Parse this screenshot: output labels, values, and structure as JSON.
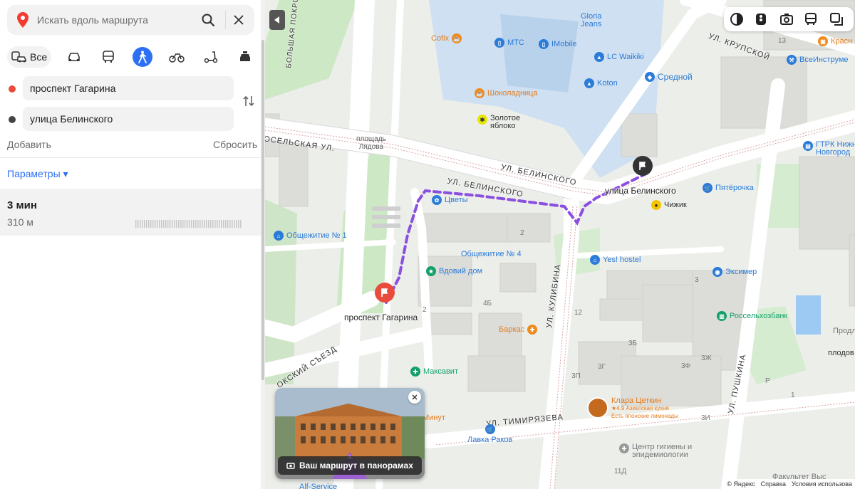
{
  "search": {
    "placeholder": "Искать вдоль маршрута"
  },
  "modes": {
    "all_label": "Все",
    "items": [
      "car-icon",
      "bus-icon",
      "pedestrian-icon",
      "bicycle-icon",
      "scooter-icon",
      "taxi-icon"
    ],
    "active": "pedestrian-icon"
  },
  "route": {
    "from": "проспект Гагарина",
    "to": "улица Белинского",
    "add_label": "Добавить",
    "reset_label": "Сбросить",
    "params_label": "Параметры ▾",
    "time": "3 мин",
    "distance": "310 м"
  },
  "colors": {
    "accent": "#2d6ff5",
    "start_marker": "#e94c3c",
    "end_marker": "#333333",
    "route_line": "#8a4fe0",
    "from_dot": "#e94c3c",
    "to_dot": "#444444"
  },
  "map": {
    "streets": {
      "belinskogo_1": "УЛ. БЕЛИНСКОГО",
      "belinskogo_2": "УЛ. БЕЛИНСКОГО",
      "pokrovskaya": "БОЛЬШАЯ ПОКРОВСКАЯ УЛ.",
      "krasnoselskaya": "СНОСЕЛЬСКАЯ УЛ.",
      "oksky": "ОКСКИЙ СЪЕЗД",
      "timiryazeva": "УЛ. ТИМИРЯЗЕВА",
      "kulibina": "УЛ. КУЛИБИНА",
      "krupskoy": "УЛ. КРУПСКОЙ",
      "pushkina": "УЛ. ПУШКИНА"
    },
    "labels": {
      "square": "площадь\nЛядова",
      "square_1": "площадь",
      "square_2": "Лядова"
    },
    "pois": {
      "gloria": "Gloria\nJeans",
      "gloria_1": "Gloria",
      "gloria_2": "Jeans",
      "cofix": "Cofix",
      "mts": "МТС",
      "imobile": "IMobile",
      "lcw": "LC Waikiki",
      "sredny": "Средной",
      "koton": "Koton",
      "shokoladnitsa": "Шоколадница",
      "zoloto_1": "Золотое",
      "zoloto_2": "яблоко",
      "krasny": "Красн",
      "vseinstr": "ВсеИнструме",
      "gtrk_1": "ГТРК Нижн",
      "gtrk_2": "Новгород",
      "pyaterochka": "Пятёрочка",
      "chizhik": "Чижик",
      "tsvety": "Цветы",
      "obsh1": "Общежитие № 1",
      "obsh4": "Общежитие № 4",
      "vdovy": "Вдовий дом",
      "yes": "Yes! hostel",
      "eksimer": "Эксимер",
      "rosselkhoz": "Россельхозбанк",
      "barkas": "Баркас",
      "maksavit": "Максавит",
      "klara": "Клара Цеткин",
      "klara_sub1": "★4.9 Азиатская кухня",
      "klara_sub2": "Есть японские лимонады",
      "lavka": "Лавка Раков",
      "minut": "Минут",
      "centr_1": "Центр гигиены и",
      "centr_2": "эпидемиологии",
      "prodl": "Продле",
      "plodov": "плодов",
      "fakultet": "Факультет Выс",
      "alf": "Alf-Service"
    },
    "house_numbers": [
      "13",
      "2",
      "4Б",
      "2",
      "3",
      "3Б",
      "3Ж",
      "3Ф",
      "3П",
      "3Г",
      "3И",
      "1",
      "11Д",
      "12",
      "Р"
    ],
    "marker_start_label": "проспект Гагарина",
    "marker_end_label": "улица Белинского",
    "panorama_caption": "Ваш маршрут в панорамах",
    "footer": [
      "© Яндекс",
      "Справка",
      "Условия использова"
    ]
  }
}
